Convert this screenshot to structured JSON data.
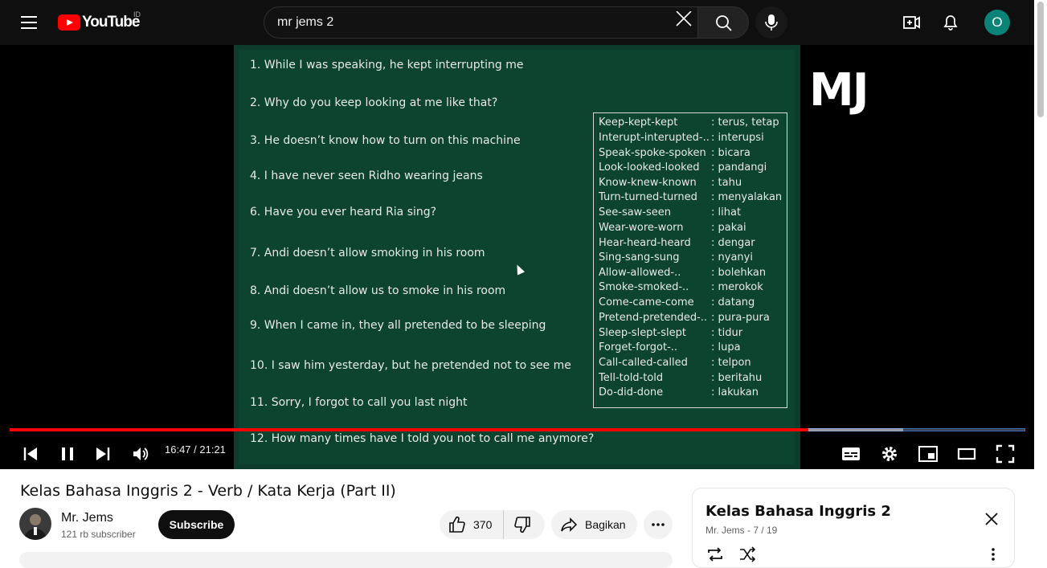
{
  "header": {
    "logo_text": "YouTube",
    "country_code": "ID",
    "search_value": "mr jems 2",
    "avatar_letter": "O"
  },
  "slide": {
    "sentences": [
      "1. While I was speaking, he kept interrupting me",
      "2. Why do you keep looking at me like that?",
      "3. He doesn’t know how to turn on this machine",
      "4. I have never seen Ridho wearing jeans",
      "6. Have you ever heard Ria sing?",
      "7. Andi doesn’t allow smoking in his room",
      "8. Andi doesn’t allow us to smoke in his room",
      "9. When I came in, they all pretended to be sleeping",
      "10. I saw him yesterday, but he pretended not to see me",
      "11. Sorry, I forgot to call you last night",
      "12. How many times have I told you not to call me anymore?"
    ],
    "vocab": [
      {
        "verb": "Keep-kept-kept",
        "meaning": ": terus, tetap"
      },
      {
        "verb": "Interupt-interupted-..",
        "meaning": ": interupsi"
      },
      {
        "verb": "Speak-spoke-spoken",
        "meaning": ": bicara"
      },
      {
        "verb": "Look-looked-looked",
        "meaning": ": pandangi"
      },
      {
        "verb": "Know-knew-known",
        "meaning": ": tahu"
      },
      {
        "verb": "Turn-turned-turned",
        "meaning": ": menyalakan"
      },
      {
        "verb": "See-saw-seen",
        "meaning": ": lihat"
      },
      {
        "verb": "Wear-wore-worn",
        "meaning": ": pakai"
      },
      {
        "verb": "Hear-heard-heard",
        "meaning": ": dengar"
      },
      {
        "verb": "Sing-sang-sung",
        "meaning": ": nyanyi"
      },
      {
        "verb": "Allow-allowed-..",
        "meaning": ": bolehkan"
      },
      {
        "verb": "Smoke-smoked-..",
        "meaning": ": merokok"
      },
      {
        "verb": "Come-came-come",
        "meaning": ": datang"
      },
      {
        "verb": "Pretend-pretended-..",
        "meaning": ": pura-pura"
      },
      {
        "verb": "Sleep-slept-slept",
        "meaning": ": tidur"
      },
      {
        "verb": "Forget-forgot-..",
        "meaning": ": lupa"
      },
      {
        "verb": "Call-called-called",
        "meaning": ": telpon"
      },
      {
        "verb": "Tell-told-told",
        "meaning": ": beritahu"
      },
      {
        "verb": "Do-did-done",
        "meaning": ": lakukan"
      }
    ],
    "watermark": "MJ"
  },
  "player": {
    "time": "16:47 / 21:21",
    "played_fraction": 0.786,
    "buffered_fraction": 0.88
  },
  "video": {
    "title": "Kelas Bahasa Inggris 2 - Verb / Kata Kerja (Part II)",
    "channel_name": "Mr. Jems",
    "subscribers": "121 rb subscriber",
    "subscribe_label": "Subscribe",
    "likes": "370",
    "share_label": "Bagikan"
  },
  "playlist": {
    "title": "Kelas Bahasa Inggris 2",
    "meta": "Mr. Jems - 7 / 19"
  },
  "colors": {
    "accent": "#ff0000",
    "board": "#0c4430",
    "avatar": "#0b8377"
  }
}
